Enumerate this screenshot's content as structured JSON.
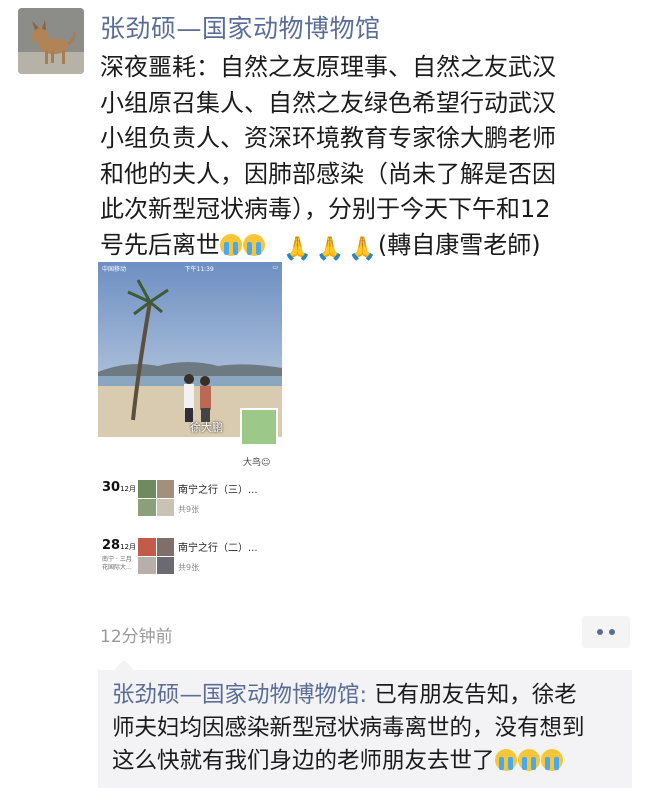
{
  "post": {
    "author": "张劲硕—国家动物博物馆",
    "text_lines": [
      "深夜噩耗：自然之友原理事、自然之友武汉",
      "小组原召集人、自然之友绿色希望行动武汉",
      "小组负责人、资深环境教育专家徐大鹏老师",
      "和他的夫人，因肺部感染（尚未了解是否因",
      "此次新型冠状病毒），分别于今天下午和12",
      "号先后离世"
    ],
    "text_suffix": "(轉自康雪老師)",
    "emoji_cry": "loudly-crying-face-emoji",
    "emoji_pray": "folded-hands-emoji",
    "time": "12分钟前"
  },
  "shared_image": {
    "status_carrier": "中国移动",
    "status_time": "下午11:39",
    "profile_name": "徐大鹏",
    "nickname": "大鸟",
    "entries": [
      {
        "day": "30",
        "month": "12月",
        "title": "南宁之行（三）...",
        "count": "共9张",
        "location": ""
      },
      {
        "day": "28",
        "month": "12月",
        "title": "南宁之行（二）...",
        "count": "共9张",
        "location": "南宁 · 三月花国际大..."
      }
    ]
  },
  "comment": {
    "author": "张劲硕—国家动物博物馆",
    "colon": ": ",
    "line1": "已有朋友告知，徐老",
    "line2": "师夫妇均因感染新型冠状病毒离世的，没有想到",
    "line3": "这么快就有我们身边的老师朋友去世了"
  },
  "colors": {
    "name": "#5a6d96",
    "text": "#1b1b1b",
    "time": "#9a9a9a",
    "comment_bg": "#f3f3f5"
  }
}
